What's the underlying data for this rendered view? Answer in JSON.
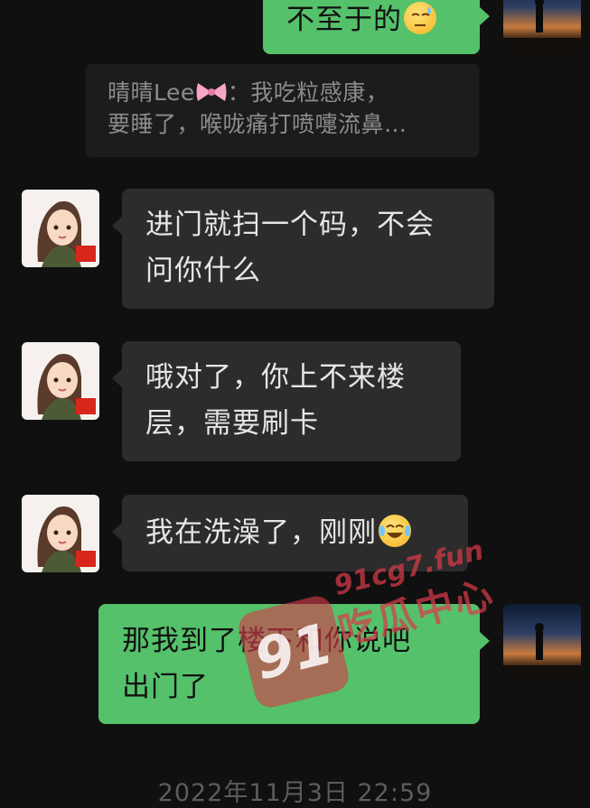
{
  "messages": {
    "m0_text": "不至于的",
    "quote_sender": "晴晴Lee",
    "quote_line1": "：我吃粒感康，",
    "quote_line2": "要睡了，喉咙痛打喷嚏流鼻…",
    "m1_line1": "进门就扫一个码，不会",
    "m1_line2": "问你什么",
    "m2_line1": "哦对了，你上不来楼",
    "m2_line2": "层，需要刷卡",
    "m3_text": "我在洗澡了，刚刚",
    "m4_line1": "那我到了楼下和你说吧",
    "m4_line2": "出门了"
  },
  "timestamp": "2022年11月3日 22:59",
  "watermark": {
    "number": "91",
    "domain": "91cg7.fun",
    "name": "吃瓜中心"
  },
  "colors": {
    "background": "#101010",
    "incoming_bubble": "#2c2c2c",
    "outgoing_bubble": "#55c16b",
    "watermark": "#d83a4a"
  }
}
